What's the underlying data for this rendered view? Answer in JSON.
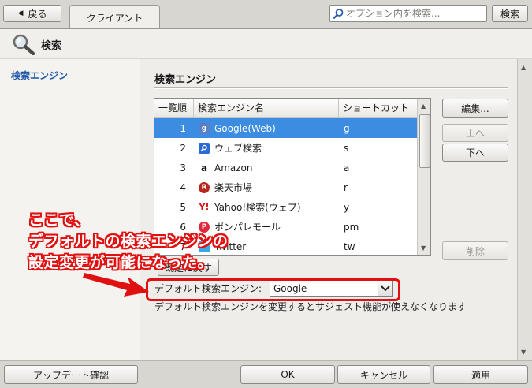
{
  "topbar": {
    "back_label": "戻る",
    "tab_label": "クライアント",
    "search_placeholder": "オプション内を検索...",
    "search_button": "検索"
  },
  "header": {
    "title": "検索"
  },
  "sidebar": {
    "items": [
      {
        "label": "検索エンジン"
      }
    ]
  },
  "section": {
    "title": "検索エンジン"
  },
  "list": {
    "columns": [
      "一覧順",
      "検索エンジン名",
      "ショートカット"
    ],
    "rows": [
      {
        "order": "1",
        "name": "Google(Web)",
        "shortcut": "g",
        "icon": "google-icon",
        "selected": true
      },
      {
        "order": "2",
        "name": "ウェブ検索",
        "shortcut": "s",
        "icon": "web-search-icon",
        "selected": false
      },
      {
        "order": "3",
        "name": "Amazon",
        "shortcut": "a",
        "icon": "amazon-icon",
        "selected": false
      },
      {
        "order": "4",
        "name": "楽天市場",
        "shortcut": "r",
        "icon": "rakuten-icon",
        "selected": false
      },
      {
        "order": "5",
        "name": "Yahoo!検索(ウェブ)",
        "shortcut": "y",
        "icon": "yahoo-icon",
        "selected": false
      },
      {
        "order": "6",
        "name": "ポンパレモール",
        "shortcut": "pm",
        "icon": "ponpare-icon",
        "selected": false
      },
      {
        "order": "7",
        "name": "Twitter",
        "shortcut": "tw",
        "icon": "twitter-icon",
        "selected": false
      }
    ]
  },
  "buttons": {
    "edit": "編集...",
    "up": "上へ",
    "down": "下へ",
    "delete": "削除",
    "restore": "既定に戻す"
  },
  "default_engine": {
    "label": "デフォルト検索エンジン:",
    "value": "Google",
    "hint": "デフォルト検索エンジンを変更するとサジェスト機能が使えなくなります"
  },
  "annotation": {
    "lines": [
      "ここで、",
      "デフォルトの検索エンジンの",
      "設定変更が可能になった。"
    ]
  },
  "footer": {
    "update_check": "アップデート確認",
    "ok": "OK",
    "cancel": "キャンセル",
    "apply": "適用"
  },
  "colors": {
    "selection": "#3c8de2",
    "accent_link": "#1f56a8",
    "annotation_red": "#e01010"
  }
}
